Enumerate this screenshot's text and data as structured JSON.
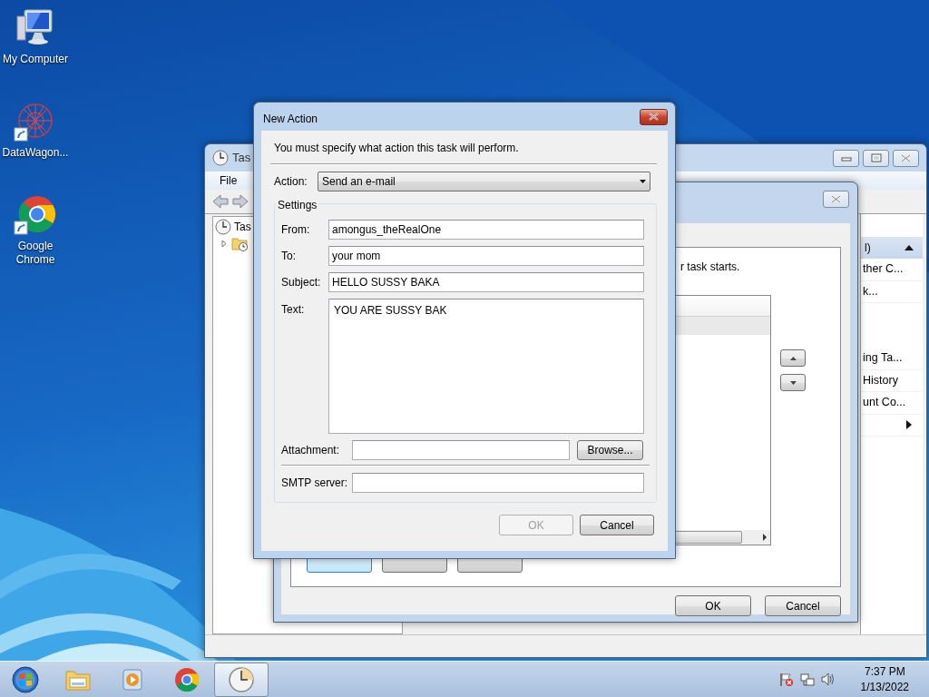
{
  "desktop_icons": [
    {
      "kind": "computer",
      "label": "My Computer"
    },
    {
      "kind": "graph",
      "label": "DataWagon..."
    },
    {
      "kind": "browser",
      "label": "Google Chrome"
    }
  ],
  "task_scheduler": {
    "title": "Tas",
    "menu": [
      "File"
    ],
    "tree": {
      "label": "Tas",
      "children": [
        {
          "expanded": false
        }
      ]
    },
    "actions": {
      "header": "l)",
      "items": [
        {
          "kind": "text",
          "label": "ther C..."
        },
        {
          "kind": "text",
          "label": "k..."
        },
        {
          "kind": "text",
          "label": "ing Ta..."
        },
        {
          "kind": "text",
          "label": "History"
        },
        {
          "kind": "text",
          "label": "unt Co..."
        },
        {
          "kind": "submenu"
        }
      ]
    }
  },
  "create_task": {
    "hint": "r task starts.",
    "buttons": [
      "OK",
      "Cancel"
    ]
  },
  "new_action": {
    "title": "New Action",
    "prompt": "You must specify what action this task will perform.",
    "action": {
      "label": "Action:",
      "value": "Send an e-mail"
    },
    "group": "Settings",
    "fields": [
      {
        "kind": "line",
        "label": "From:",
        "value": "amongus_theRealOne"
      },
      {
        "kind": "line",
        "label": "To:",
        "value": "your mom"
      },
      {
        "kind": "line",
        "label": "Subject:",
        "value": "HELLO SUSSY BAKA"
      },
      {
        "kind": "multiline",
        "label": "Text:",
        "value": "YOU ARE SUSSY BAK"
      },
      {
        "kind": "file",
        "label": "Attachment:",
        "button": "Browse..."
      },
      {
        "kind": "server",
        "label": "SMTP server:"
      }
    ],
    "buttons": [
      {
        "label": "OK",
        "disabled": true
      },
      {
        "label": "Cancel",
        "disabled": false
      }
    ]
  },
  "taskbar": {
    "items": [
      {
        "kind": "start",
        "selected": false
      },
      {
        "kind": "folder",
        "selected": false
      },
      {
        "kind": "media",
        "selected": false
      },
      {
        "kind": "browser",
        "selected": false
      },
      {
        "kind": "clock",
        "selected": true
      }
    ],
    "tray": {
      "time": "7:37 PM",
      "date": "1/13/2022"
    }
  }
}
